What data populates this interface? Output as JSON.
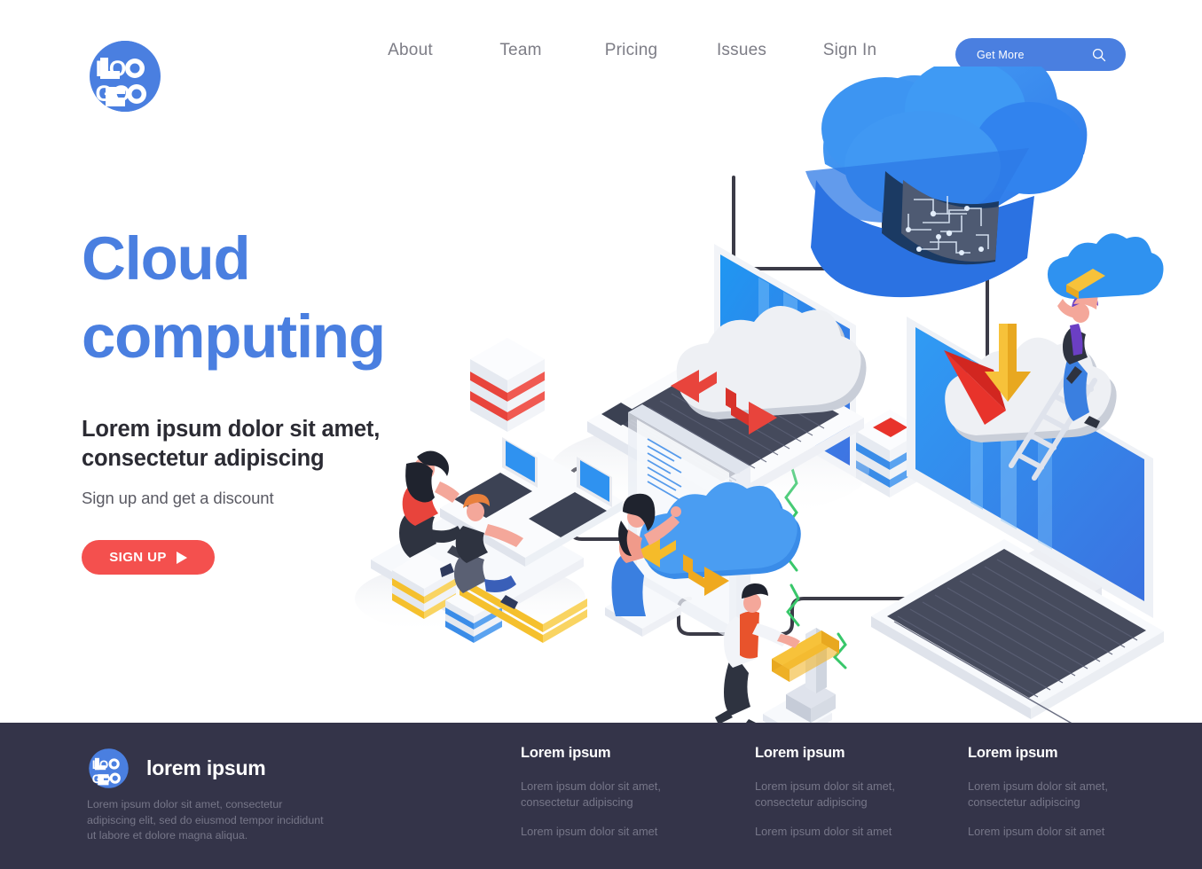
{
  "header": {
    "logo": {
      "line1": "LO",
      "line2": "GO",
      "icon": "circular-logo-icon"
    },
    "nav": [
      {
        "label": "About"
      },
      {
        "label": "Team"
      },
      {
        "label": "Pricing"
      },
      {
        "label": "Issues"
      },
      {
        "label": "Sign In"
      }
    ],
    "cta": {
      "label": "Get More",
      "icon": "search-icon"
    }
  },
  "hero": {
    "title_line1": "Cloud",
    "title_line2": "computing",
    "subtitle": "Lorem ipsum dolor sit amet, consectetur adipiscing",
    "description": "Sign up and get a discount",
    "button_label": "SIGN UP",
    "button_icon": "play-triangle-icon"
  },
  "illustration": {
    "name": "isometric-cloud-computing-illustration",
    "elements": [
      "cloud-with-circuit-board",
      "laptop-with-cloud-sync-screen",
      "desktop-monitor-with-cloud-download",
      "transparent-display-panel",
      "isometric-keyboard",
      "server-stack-red",
      "server-stack-blue",
      "characters-at-desk",
      "character-touching-panel",
      "character-with-lever",
      "character-on-ladder"
    ]
  },
  "footer": {
    "logo": {
      "line1": "LO",
      "line2": "GO",
      "icon": "circular-logo-icon"
    },
    "brand_name": "lorem ipsum",
    "about": "Lorem ipsum dolor sit amet, consectetur adipiscing elit, sed do eiusmod tempor incididunt ut labore et dolore magna aliqua.",
    "columns": [
      {
        "title": "Lorem ipsum",
        "links": [
          "Lorem ipsum dolor sit amet, consectetur adipiscing",
          "Lorem ipsum dolor sit amet"
        ]
      },
      {
        "title": "Lorem ipsum",
        "links": [
          "Lorem ipsum dolor sit amet, consectetur adipiscing",
          "Lorem ipsum dolor sit amet"
        ]
      },
      {
        "title": "Lorem ipsum",
        "links": [
          "Lorem ipsum dolor sit amet, consectetur adipiscing",
          "Lorem ipsum dolor sit amet"
        ]
      }
    ]
  },
  "colors": {
    "brand_blue": "#4a7fe0",
    "accent_red": "#f4504e",
    "footer_bg": "#343449",
    "nav_text": "#7d7d86",
    "heading_dark": "#2b2b33",
    "footer_muted": "#767688",
    "accent_yellow": "#f7c23a"
  }
}
